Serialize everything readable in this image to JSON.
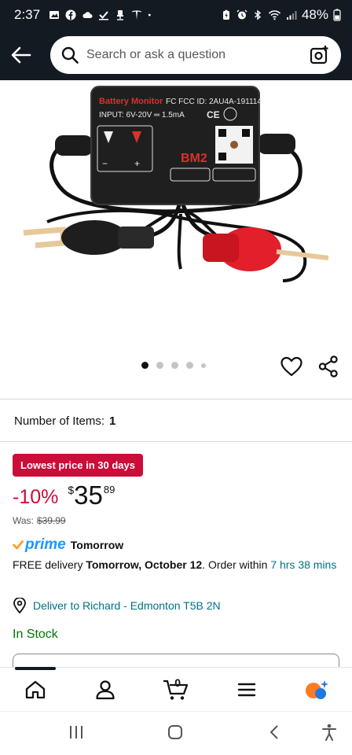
{
  "status_bar": {
    "time": "2:37",
    "battery_percent": "48%"
  },
  "search": {
    "placeholder": "Search or ask a question"
  },
  "carousel": {
    "total_dots": 5,
    "active_index": 0
  },
  "product": {
    "number_of_items_label": "Number of Items:",
    "number_of_items_value": "1"
  },
  "pricing": {
    "deal_badge": "Lowest price in 30 days",
    "discount": "-10%",
    "currency_symbol": "$",
    "price_whole": "35",
    "price_fraction": "89",
    "was_label": "Was:",
    "was_price": "$39.99",
    "accent_color": "#cc0c39"
  },
  "delivery": {
    "prime_word": "prime",
    "prime_day": "Tomorrow",
    "free_delivery": "FREE delivery",
    "delivery_date": "Tomorrow, October 12",
    "order_within": ". Order within",
    "countdown": "7 hrs 38 mins",
    "deliver_to": "Deliver to Richard - Edmonton T5B 2N"
  },
  "availability": {
    "stock_status": "In Stock",
    "stock_color": "#007600"
  },
  "bottom_nav": {
    "items": [
      "home-icon",
      "account-icon",
      "cart-icon",
      "menu-icon",
      "rufus-icon"
    ],
    "cart_count": "0"
  },
  "system_nav": {
    "items": [
      "recents-icon",
      "home-circle-icon",
      "back-chevron-icon",
      "accessibility-icon"
    ]
  }
}
